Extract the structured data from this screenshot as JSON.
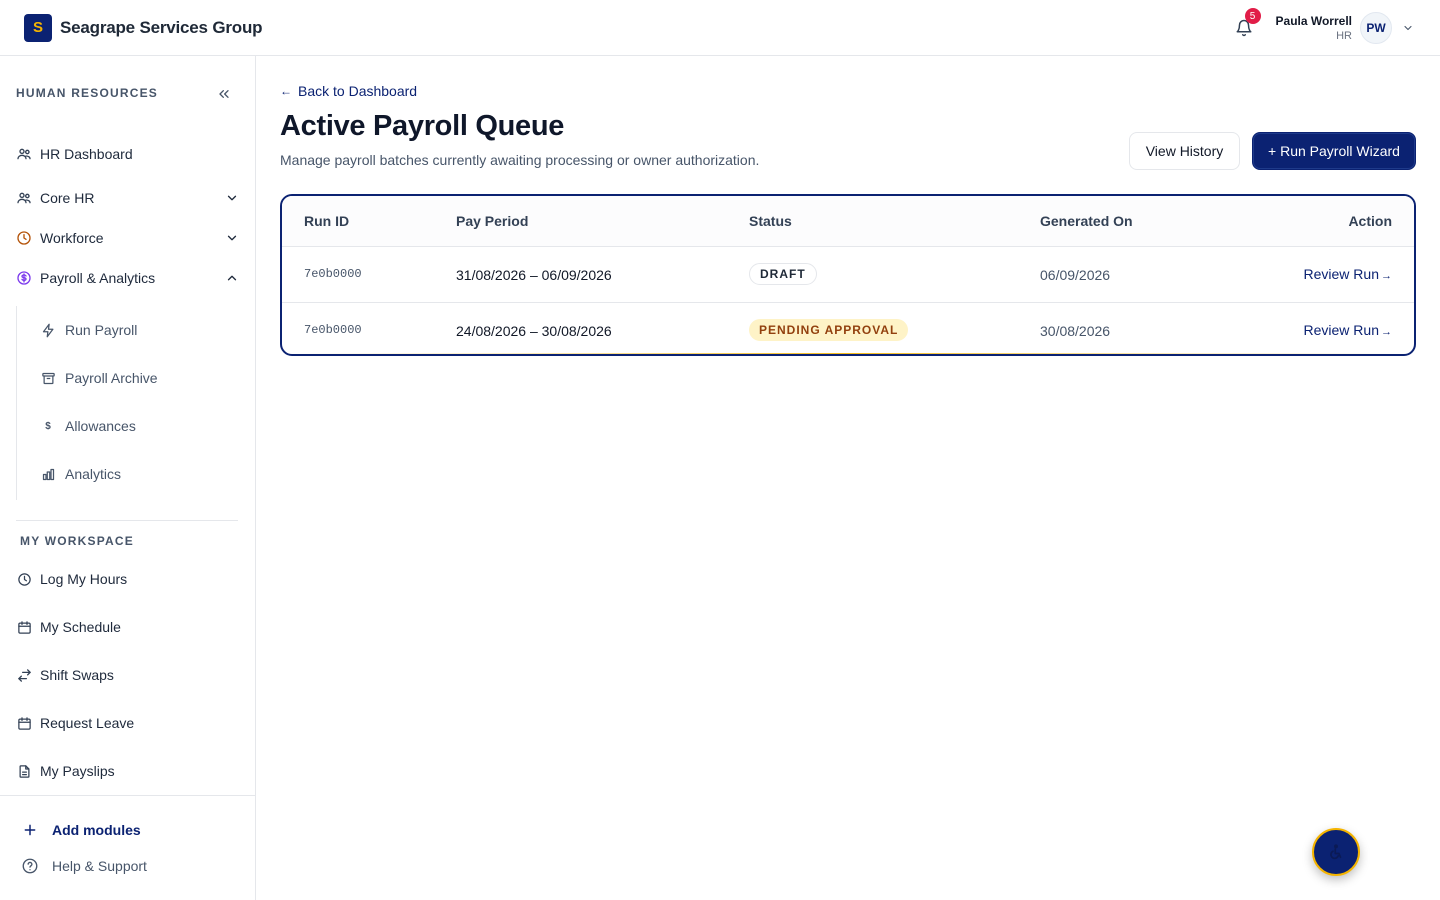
{
  "brand": {
    "logo_letter": "S",
    "name": "Seagrape Services Group"
  },
  "header": {
    "notifications_count": "5",
    "user_name": "Paula Worrell",
    "user_role": "HR",
    "avatar_initials": "PW"
  },
  "sidebar": {
    "section_label": "HUMAN RESOURCES",
    "items": [
      {
        "label": "HR Dashboard",
        "icon": "users-icon"
      },
      {
        "label": "Core HR",
        "icon": "users-icon",
        "expanded": false
      },
      {
        "label": "Workforce",
        "icon": "clock-icon",
        "expanded": false
      },
      {
        "label": "Payroll & Analytics",
        "icon": "dollar-circle-icon",
        "expanded": true
      }
    ],
    "payroll_sub_items": [
      {
        "label": "Run Payroll",
        "icon": "lightning-icon"
      },
      {
        "label": "Payroll Archive",
        "icon": "archive-icon"
      },
      {
        "label": "Allowances",
        "icon": "dollar-icon"
      },
      {
        "label": "Analytics",
        "icon": "bar-chart-icon"
      }
    ],
    "workspace_label": "MY WORKSPACE",
    "workspace_items": [
      {
        "label": "Log My Hours",
        "icon": "clock-icon"
      },
      {
        "label": "My Schedule",
        "icon": "calendar-icon"
      },
      {
        "label": "Shift Swaps",
        "icon": "swap-icon"
      },
      {
        "label": "Request Leave",
        "icon": "calendar-icon"
      },
      {
        "label": "My Payslips",
        "icon": "document-icon"
      }
    ],
    "add_modules": "Add modules",
    "help_support": "Help & Support"
  },
  "main": {
    "back_link": "Back to Dashboard",
    "back_arrow": "←",
    "title": "Active Payroll Queue",
    "subtitle": "Manage payroll batches currently awaiting processing or owner authorization.",
    "view_history": "View History",
    "run_wizard": "+ Run Payroll Wizard",
    "table": {
      "columns": [
        "Run ID",
        "Pay Period",
        "Status",
        "Generated On",
        "Action"
      ],
      "rows": [
        {
          "run_id": "7e0b0000",
          "pay_period": "31/08/2026 – 06/09/2026",
          "status": "DRAFT",
          "generated_on": "06/09/2026",
          "action": "Review Run",
          "arrow": "→"
        },
        {
          "run_id": "7e0b0000",
          "pay_period": "24/08/2026 – 30/08/2026",
          "status": "PENDING APPROVAL",
          "generated_on": "30/08/2026",
          "action": "Review Run",
          "arrow": "→"
        }
      ]
    }
  },
  "colors": {
    "brand_navy": "#0b2272",
    "accent_gold": "#f5b400",
    "pending_bg": "#fef3c7",
    "pending_text": "#92400e",
    "badge_red": "#e11d48"
  }
}
